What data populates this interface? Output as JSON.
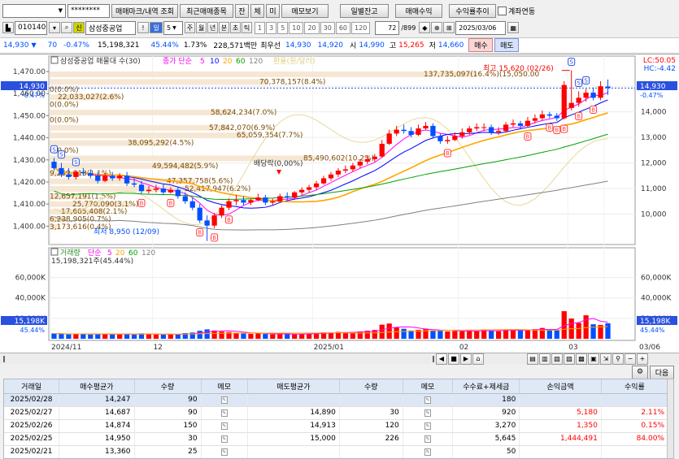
{
  "toolbar1": {
    "account_number": "",
    "password": "********",
    "buttons": [
      "매매마크/내역 조회",
      "최근매매종목",
      "잔",
      "체",
      "미",
      "메모보기",
      "일별잔고",
      "매매수익",
      "수익률추이"
    ],
    "account_link_label": "계좌연동"
  },
  "toolbar2": {
    "stock_code": "010140",
    "credit_badge": "신",
    "stock_name": "삼성중공업",
    "period_unit": "일",
    "period_value": "5",
    "period_tabs": [
      "주",
      "월",
      "년",
      "분",
      "초",
      "틱"
    ],
    "interval_options": [
      "1",
      "3",
      "5",
      "10",
      "20",
      "30",
      "60",
      "120"
    ],
    "view_count": "72",
    "view_total": "/899",
    "date": "2025/03/06"
  },
  "quote": {
    "price": "14,930",
    "change": "70",
    "change_pct": "-0.47%",
    "volume": "15,198,321",
    "volume_ratio": "45.44%",
    "turnover_rate": "1.73%",
    "amount": "228,571백만",
    "best_ask_label": "최우선",
    "best_ask": "14,930",
    "best_bid": "14,920",
    "open_label": "시",
    "open": "14,990",
    "high_label": "고",
    "high": "15,265",
    "low_label": "저",
    "low": "14,660",
    "buy_button": "매수",
    "sell_button": "매도"
  },
  "colors": {
    "up": "#ff0000",
    "down": "#0050ff",
    "ma5": "#ff00ff",
    "ma10": "#0000ff",
    "ma20": "#ffa500",
    "ma60": "#00a000",
    "ma120": "#808080",
    "exchange": "#e6d99a",
    "buy_mark": "#ff3b3b",
    "sell_mark": "#2a50e0"
  },
  "chart": {
    "legend": {
      "name": "삼성중공업 매물대 수(30)",
      "price_label": "종가 단순",
      "ma_periods": [
        "5",
        "10",
        "20",
        "60",
        "120"
      ],
      "exchange_label": "환율(원/달러)"
    },
    "corner_lc": "LC:50.05",
    "corner_hc": "HC:-4.42",
    "left_price_box": "14,930",
    "left_price_pct": "-0.47%",
    "right_price_box": "14,930",
    "right_price_pct": "-0.47%",
    "high_annotation": "최고 15,620 (02/26)",
    "low_annotation": "최저 8,950 (12/09)",
    "dividend_label": "배당락(0,00%)",
    "left_axis": [
      "1,470.00",
      "1,460.00",
      "1,450.00",
      "1,440.00",
      "1,430.00",
      "1,420.00",
      "1,410.00",
      "1,400.00"
    ],
    "right_axis": [
      "15,000",
      "14,000",
      "13,000",
      "12,000",
      "11,000",
      "10,000"
    ],
    "volume_profile": [
      "137,735,097(16.4%)(15,050.00",
      "70,378,157(8.4%)",
      "0(0.0%)",
      "22,033,027(2.6%)",
      "0(0.0%)",
      "58,624,234(7.0%)",
      "0(0.0%)",
      "57,842,070(6.9%)",
      "65,059,354(7.7%)",
      "38,095,292(4.5%)",
      "0(0.0%)",
      "85,490,602(10.2%)",
      "49,594,482(5.9%)",
      "9,259,813(1.1%)",
      "47,357,758(5.6%)",
      "52,417,947(6.2%)",
      "12,657,191(1.5%)",
      "25,770,090(3.1%)",
      "17,665,408(2.1%)",
      "6,238,905(0.7%)",
      "3,173,616(0.4%)"
    ],
    "volume_legend": {
      "name": "거래량",
      "type": "단순",
      "periods": [
        "5",
        "20",
        "60",
        "120"
      ],
      "value_line": "15,198,321주(45.44%)"
    },
    "volume_axis": [
      "60,000K",
      "40,000K",
      "20,000K"
    ],
    "volume_box": "15,198K",
    "volume_pct": "45.44%",
    "date_axis": [
      "2024/11",
      "12",
      "2025/01",
      "02",
      "03",
      "03/06"
    ]
  },
  "chart_data": {
    "type": "candlestick",
    "dates": [
      "11/08",
      "11/11",
      "11/12",
      "11/13",
      "11/14",
      "11/15",
      "11/18",
      "11/19",
      "11/20",
      "11/21",
      "11/22",
      "11/25",
      "11/26",
      "11/27",
      "11/28",
      "11/29",
      "12/02",
      "12/03",
      "12/04",
      "12/05",
      "12/06",
      "12/09",
      "12/10",
      "12/11",
      "12/12",
      "12/13",
      "12/16",
      "12/17",
      "12/18",
      "12/19",
      "12/20",
      "12/23",
      "12/24",
      "12/26",
      "12/27",
      "12/30",
      "01/02",
      "01/03",
      "01/06",
      "01/07",
      "01/08",
      "01/09",
      "01/10",
      "01/13",
      "01/14",
      "01/15",
      "01/16",
      "01/17",
      "01/20",
      "01/21",
      "01/22",
      "01/23",
      "01/24",
      "01/31",
      "02/03",
      "02/04",
      "02/05",
      "02/06",
      "02/07",
      "02/10",
      "02/11",
      "02/12",
      "02/13",
      "02/14",
      "02/17",
      "02/18",
      "02/19",
      "02/20",
      "02/21",
      "02/24",
      "02/25",
      "02/26",
      "02/27",
      "02/28",
      "03/04",
      "03/05",
      "03/06"
    ],
    "open": [
      12050,
      11800,
      11550,
      11450,
      11650,
      11600,
      11500,
      11300,
      11500,
      11400,
      11500,
      11200,
      11150,
      10900,
      10950,
      11000,
      10850,
      10950,
      10700,
      10500,
      10250,
      9750,
      9550,
      9950,
      10250,
      10500,
      10550,
      10450,
      10550,
      10650,
      10450,
      10500,
      10700,
      10650,
      10850,
      10950,
      11050,
      11200,
      11400,
      11550,
      11700,
      11750,
      11900,
      12050,
      12150,
      12250,
      12750,
      13150,
      13300,
      13250,
      13100,
      13350,
      13450,
      13050,
      12850,
      12900,
      13050,
      13200,
      13350,
      13400,
      13400,
      13200,
      13250,
      13500,
      13550,
      13450,
      13650,
      13750,
      13900,
      13850,
      13750,
      14150,
      14350,
      14550,
      14750,
      14550,
      14990
    ],
    "close": [
      11800,
      11550,
      11450,
      11650,
      11600,
      11500,
      11300,
      11500,
      11400,
      11500,
      11200,
      11150,
      10900,
      10950,
      11000,
      10850,
      10950,
      10700,
      10500,
      10250,
      9750,
      9550,
      9950,
      10250,
      10500,
      10550,
      10450,
      10550,
      10650,
      10450,
      10500,
      10700,
      10650,
      10850,
      10950,
      11050,
      11200,
      11400,
      11550,
      11700,
      11750,
      11900,
      12050,
      12150,
      12250,
      12750,
      13150,
      13300,
      13250,
      13100,
      13350,
      13450,
      13050,
      12850,
      12900,
      13050,
      13200,
      13350,
      13400,
      13400,
      13200,
      13250,
      13500,
      13550,
      13450,
      13650,
      13750,
      13900,
      13850,
      13750,
      15050,
      14350,
      14550,
      14750,
      14550,
      15000,
      14930
    ],
    "high": [
      12200,
      12000,
      11800,
      11700,
      11800,
      11750,
      11650,
      11600,
      11650,
      11600,
      11650,
      11400,
      11300,
      11100,
      11150,
      11200,
      11050,
      11050,
      10850,
      10650,
      10400,
      9950,
      10050,
      10350,
      10600,
      10750,
      10700,
      10600,
      10800,
      10750,
      10600,
      10800,
      10850,
      10900,
      11050,
      11150,
      11300,
      11500,
      11650,
      11800,
      11900,
      12000,
      12150,
      12300,
      12350,
      12900,
      13300,
      13450,
      13500,
      13400,
      13500,
      13600,
      13550,
      13150,
      13050,
      13200,
      13350,
      13450,
      13550,
      13550,
      13500,
      13400,
      13600,
      13700,
      13650,
      13800,
      13900,
      14050,
      14000,
      13950,
      15200,
      15620,
      14800,
      14900,
      14950,
      15200,
      15265
    ],
    "low": [
      11700,
      11450,
      11350,
      11350,
      11500,
      11400,
      11200,
      11250,
      11300,
      11300,
      11100,
      11050,
      10800,
      10800,
      10850,
      10750,
      10800,
      10600,
      10400,
      10150,
      9650,
      8950,
      9450,
      9850,
      10150,
      10350,
      10350,
      10350,
      10500,
      10350,
      10350,
      10450,
      10550,
      10600,
      10750,
      10850,
      10950,
      11150,
      11300,
      11450,
      11600,
      11650,
      11800,
      11950,
      12050,
      12200,
      12700,
      13050,
      13150,
      13000,
      13050,
      13300,
      12950,
      12750,
      12750,
      12850,
      12950,
      13100,
      13250,
      13250,
      13100,
      13100,
      13200,
      13400,
      13350,
      13400,
      13550,
      13650,
      13750,
      13650,
      13700,
      14050,
      14200,
      14400,
      14450,
      14450,
      14660
    ],
    "volume": [
      5200,
      4800,
      4300,
      4900,
      4600,
      4200,
      5100,
      4700,
      4400,
      4300,
      4900,
      4100,
      5300,
      4600,
      4200,
      4000,
      4500,
      4300,
      5600,
      6100,
      7800,
      9200,
      8100,
      7000,
      6600,
      5900,
      5100,
      4800,
      5300,
      4700,
      4400,
      4600,
      4900,
      4300,
      4800,
      5200,
      5600,
      6300,
      5900,
      6700,
      6100,
      6500,
      7200,
      7900,
      8600,
      13800,
      14900,
      11200,
      9800,
      8100,
      8700,
      9900,
      8300,
      7800,
      7200,
      7600,
      7300,
      8200,
      7700,
      8400,
      7900,
      7400,
      9200,
      8800,
      8100,
      8700,
      9400,
      10600,
      8900,
      8200,
      27000,
      19800,
      15500,
      23000,
      14200,
      13500,
      15198
    ],
    "series": [
      {
        "name": "5"
      },
      {
        "name": "10"
      },
      {
        "name": "20"
      },
      {
        "name": "60"
      },
      {
        "name": "120"
      }
    ],
    "buy_marks": [
      "11/26",
      "12/02",
      "12/06",
      "12/10",
      "12/12",
      "02/03",
      "02/18",
      "02/21",
      "02/24",
      "02/25",
      "02/27",
      "03/04"
    ],
    "sell_marks": [
      "11/08",
      "11/11",
      "11/13",
      "02/26",
      "02/27",
      "02/28"
    ],
    "ylim": [
      9000,
      15800
    ],
    "volume_ylim": [
      0,
      70000
    ]
  },
  "scrollbar": {
    "buttons": [
      "◀",
      "■",
      "▶"
    ],
    "zoom": [
      "−",
      "+"
    ],
    "next_label": "다음"
  },
  "table": {
    "columns": [
      "거래일",
      "매수평균가",
      "수량",
      "메모",
      "매도평균가",
      "수량",
      "메모",
      "수수료+제세금",
      "손익금액",
      "수익률"
    ],
    "rows": [
      {
        "date": "2025/02/28",
        "buy_avg": "14,247",
        "buy_qty": "90",
        "sell_avg": "",
        "sell_qty": "",
        "fee": "180",
        "pnl": "",
        "rate": ""
      },
      {
        "date": "2025/02/27",
        "buy_avg": "14,687",
        "buy_qty": "90",
        "sell_avg": "14,890",
        "sell_qty": "30",
        "fee": "920",
        "pnl": "5,180",
        "rate": "2.11%"
      },
      {
        "date": "2025/02/26",
        "buy_avg": "14,874",
        "buy_qty": "150",
        "sell_avg": "14,913",
        "sell_qty": "120",
        "fee": "3,270",
        "pnl": "1,350",
        "rate": "0.15%"
      },
      {
        "date": "2025/02/25",
        "buy_avg": "14,950",
        "buy_qty": "30",
        "sell_avg": "15,000",
        "sell_qty": "226",
        "fee": "5,645",
        "pnl": "1,444,491",
        "rate": "84.00%"
      },
      {
        "date": "2025/02/21",
        "buy_avg": "13,360",
        "buy_qty": "25",
        "sell_avg": "",
        "sell_qty": "",
        "fee": "50",
        "pnl": "",
        "rate": ""
      }
    ]
  }
}
